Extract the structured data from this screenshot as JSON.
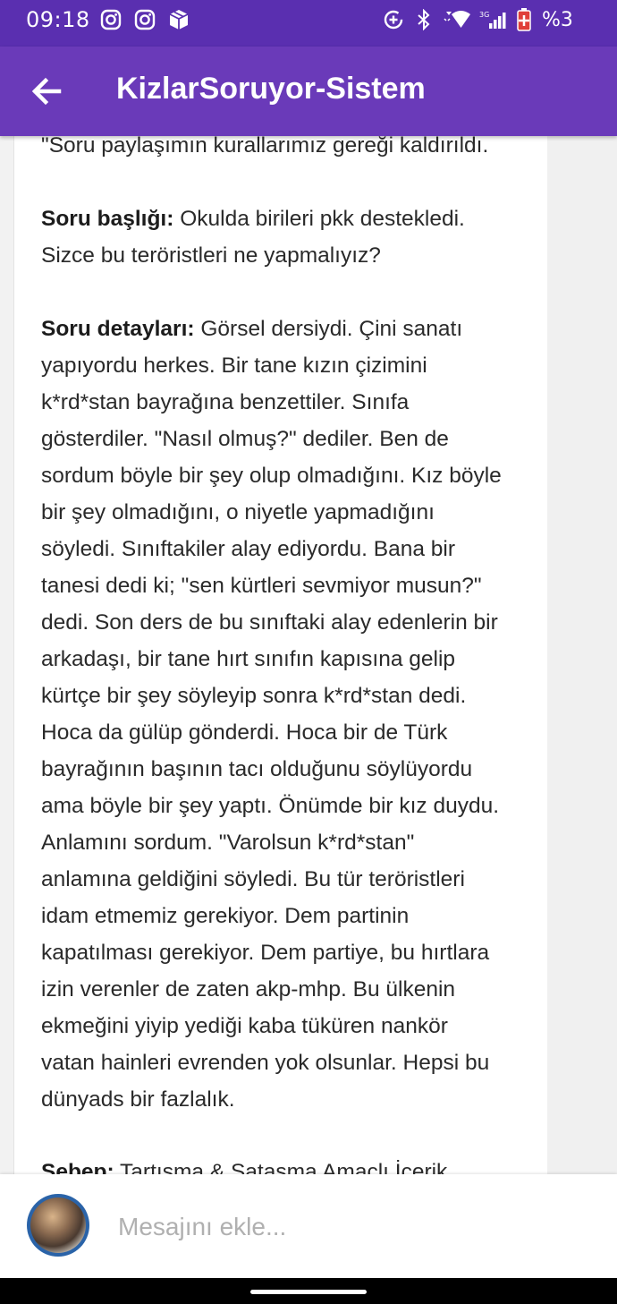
{
  "status_bar": {
    "time": "09:18",
    "left_icons": [
      "instagram-icon",
      "instagram-icon",
      "package-icon"
    ],
    "right_icons": [
      "data-saver-icon",
      "bluetooth-icon",
      "wifi-icon",
      "signal-3g-icon",
      "battery-low-icon"
    ],
    "battery": "%3"
  },
  "app_bar": {
    "title": "KizlarSoruyor-Sistem",
    "back_icon": "arrow-back-icon",
    "color": "#6a3ab9"
  },
  "message": {
    "top_line": "\"Soru paylaşımın kurallarımız gereği kaldırıldı.",
    "title_label": "Soru başlığı:",
    "title_text": " Okulda birileri pkk destekledi. Sizce bu teröristleri ne yapmalıyız?",
    "details_label": "Soru detayları:",
    "details_text": " Görsel dersiydi. Çini sanatı yapıyordu herkes. Bir tane kızın çizimini k*rd*stan bayrağına benzettiler. Sınıfa gösterdiler. \"Nasıl olmuş?\" dediler. Ben de sordum böyle bir şey olup olmadığını. Kız böyle bir şey olmadığını, o niyetle yapmadığını söyledi. Sınıftakiler alay ediyordu. Bana bir tanesi dedi ki; \"sen kürtleri sevmiyor musun?\" dedi. Son ders de bu sınıftaki alay edenlerin bir arkadaşı, bir tane hırt sınıfın kapısına gelip kürtçe bir şey söyleyip sonra k*rd*stan dedi. Hoca da gülüp gönderdi. Hoca bir de Türk bayrağının başının tacı olduğunu söylüyordu ama böyle bir şey yaptı. Önümde bir kız duydu. Anlamını sordum. \"Varolsun k*rd*stan\" anlamına geldiğini söyledi. Bu tür teröristleri idam etmemiz gerekiyor. Dem partinin kapatılması gerekiyor. Dem partiye, bu hırtlara izin verenler de zaten akp-mhp. Bu ülkenin ekmeğini yiyip yediği kaba tüküren nankör vatan hainleri evrenden yok olsunlar. Hepsi bu dünyads bir fazlalık.",
    "reason_label": "Sebep:",
    "reason_text": " Tartışma & Sataşma Amaçlı İçerik"
  },
  "composer": {
    "placeholder": "Mesajını ekle..."
  }
}
